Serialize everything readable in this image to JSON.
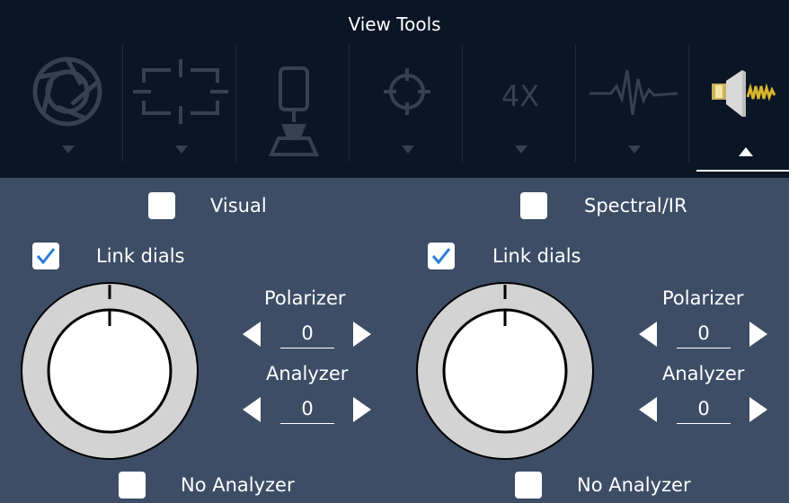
{
  "toolbar": {
    "title": "View Tools",
    "tools": [
      {
        "icon": "aperture-icon",
        "has_dropdown": true
      },
      {
        "icon": "crop-frame-icon",
        "has_dropdown": true
      },
      {
        "icon": "illuminator-icon",
        "has_dropdown": false
      },
      {
        "icon": "crosshair-icon",
        "has_dropdown": true
      },
      {
        "icon": "objective-icon",
        "label": "4X",
        "has_dropdown": true
      },
      {
        "icon": "spectrum-wave-icon",
        "has_dropdown": true
      },
      {
        "icon": "polarizer-icon",
        "active": true
      }
    ]
  },
  "panel": {
    "left": {
      "mode_label": "Visual",
      "mode_checked": false,
      "link_label": "Link dials",
      "link_checked": true,
      "polarizer_label": "Polarizer",
      "polarizer_value": "0",
      "analyzer_label": "Analyzer",
      "analyzer_value": "0",
      "no_analyzer_label": "No Analyzer",
      "no_analyzer_checked": false
    },
    "right": {
      "mode_label": "Spectral/IR",
      "mode_checked": false,
      "link_label": "Link dials",
      "link_checked": true,
      "polarizer_label": "Polarizer",
      "polarizer_value": "0",
      "analyzer_label": "Analyzer",
      "analyzer_value": "0",
      "no_analyzer_label": "No Analyzer",
      "no_analyzer_checked": false
    }
  },
  "colors": {
    "toolbar_bg": "#0a1525",
    "panel_bg": "#3d4d66",
    "disabled_icon": "#37404f",
    "check_blue": "#2a7fd6",
    "dial_ring": "#d3d3d3"
  }
}
